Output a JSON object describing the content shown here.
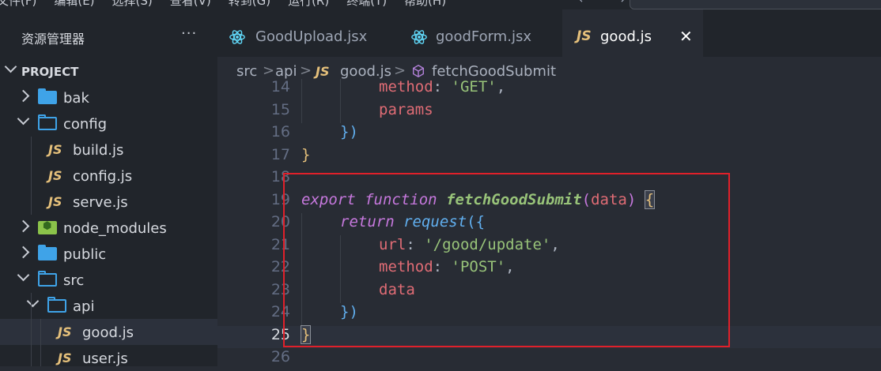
{
  "menubar": {
    "items": [
      "文件(F)",
      "编辑(E)",
      "选择(S)",
      "查看(V)",
      "转到(G)",
      "运行(R)",
      "终端(T)",
      "帮助(H)"
    ],
    "nav_arrows": "← →"
  },
  "sidebar": {
    "title": "资源管理器",
    "more": "···",
    "tree": [
      {
        "label": "PROJECT",
        "kind": "root"
      },
      {
        "label": "bak",
        "kind": "folder"
      },
      {
        "label": "config",
        "kind": "folder-open"
      },
      {
        "label": "build.js",
        "kind": "js"
      },
      {
        "label": "config.js",
        "kind": "js"
      },
      {
        "label": "serve.js",
        "kind": "js"
      },
      {
        "label": "node_modules",
        "kind": "node-folder"
      },
      {
        "label": "public",
        "kind": "folder"
      },
      {
        "label": "src",
        "kind": "folder-open"
      },
      {
        "label": "api",
        "kind": "folder-open"
      },
      {
        "label": "good.js",
        "kind": "js",
        "selected": true
      },
      {
        "label": "user.js",
        "kind": "js"
      }
    ],
    "js_badge": "JS"
  },
  "tabs": [
    {
      "label": "GoodUpload.jsx",
      "icon": "react-icon"
    },
    {
      "label": "goodForm.jsx",
      "icon": "react-icon"
    },
    {
      "label": "good.js",
      "icon": "js-icon",
      "active": true,
      "close": "✕"
    }
  ],
  "breadcrumb": {
    "parts": [
      "src",
      "api",
      "good.js",
      "fetchGoodSubmit"
    ],
    "sep": ">",
    "js_badge": "JS"
  },
  "editor": {
    "current_line": 25,
    "lines": [
      {
        "n": "14"
      },
      {
        "n": "15"
      },
      {
        "n": "16"
      },
      {
        "n": "17"
      },
      {
        "n": "18"
      },
      {
        "n": "19"
      },
      {
        "n": "20"
      },
      {
        "n": "21"
      },
      {
        "n": "22"
      },
      {
        "n": "23"
      },
      {
        "n": "24"
      },
      {
        "n": "25"
      },
      {
        "n": "26"
      }
    ],
    "tokens": {
      "method": "method",
      "colon": ": ",
      "get": "'GET'",
      "comma": ",",
      "params": "params",
      "close_call": "})",
      "close_brace": "}",
      "export": "export",
      "function": "function",
      "fn_name": "fetchGoodSubmit",
      "paren_open": "(",
      "data": "data",
      "paren_close": ")",
      "brace_open": "{",
      "return": "return",
      "request": "request",
      "call_open": "({",
      "url": "url",
      "url_val": "'/good/update'",
      "post": "'POST'"
    }
  },
  "colors": {
    "highlight_box": "#e0202a",
    "keyword": "#c678dd",
    "function": "#98c379",
    "property": "#e06c75",
    "string": "#98c379",
    "js_badge": "#e5c07b",
    "folder": "#3fa3e8",
    "react": "#61dafb"
  }
}
